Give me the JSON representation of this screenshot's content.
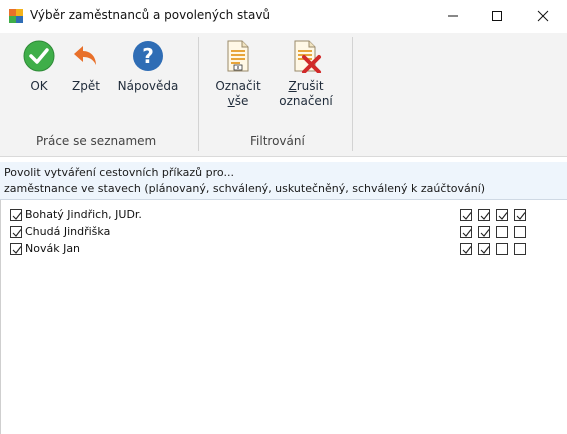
{
  "window": {
    "title": "Výběr zaměstnanců a povolených stavů",
    "controls": {
      "minimize": "—",
      "maximize": "☐",
      "close": "✕"
    }
  },
  "ribbon": {
    "buttons": [
      {
        "id": "ok",
        "label": "OK",
        "icon": "check-circle-icon",
        "color": "#3fae49"
      },
      {
        "id": "back",
        "label": "Zpět",
        "icon": "back-arrow-icon",
        "color": "#e8702a"
      },
      {
        "id": "help",
        "label": "Nápověda",
        "icon": "help-icon",
        "color": "#2f6db5"
      },
      {
        "id": "mark_all",
        "label_line1": "Označit",
        "label_line2_underlined": "v",
        "label_line2_rest": "še",
        "icon": "document-mark-icon"
      },
      {
        "id": "unmark",
        "label_line1_underlined": "Z",
        "label_line1_rest": "rušit",
        "label_line2": "označení",
        "icon": "document-cancel-icon",
        "color": "#d12a2a"
      }
    ],
    "groups": [
      {
        "label": "Práce se seznamem"
      },
      {
        "label": "Filtrování"
      }
    ]
  },
  "info": {
    "line1": "Povolit vytváření cestovních příkazů pro...",
    "line2": "zaměstnance ve stavech (plánovaný, schválený, uskutečněný, schválený k  zaúčtování)"
  },
  "employees": [
    {
      "name": "Bohatý Jindřich, JUDr.",
      "checked": true,
      "states": [
        true,
        true,
        true,
        true
      ]
    },
    {
      "name": "Chudá Jindřiška",
      "checked": true,
      "states": [
        true,
        true,
        false,
        false
      ]
    },
    {
      "name": "Novák Jan",
      "checked": true,
      "states": [
        true,
        true,
        false,
        false
      ]
    }
  ]
}
